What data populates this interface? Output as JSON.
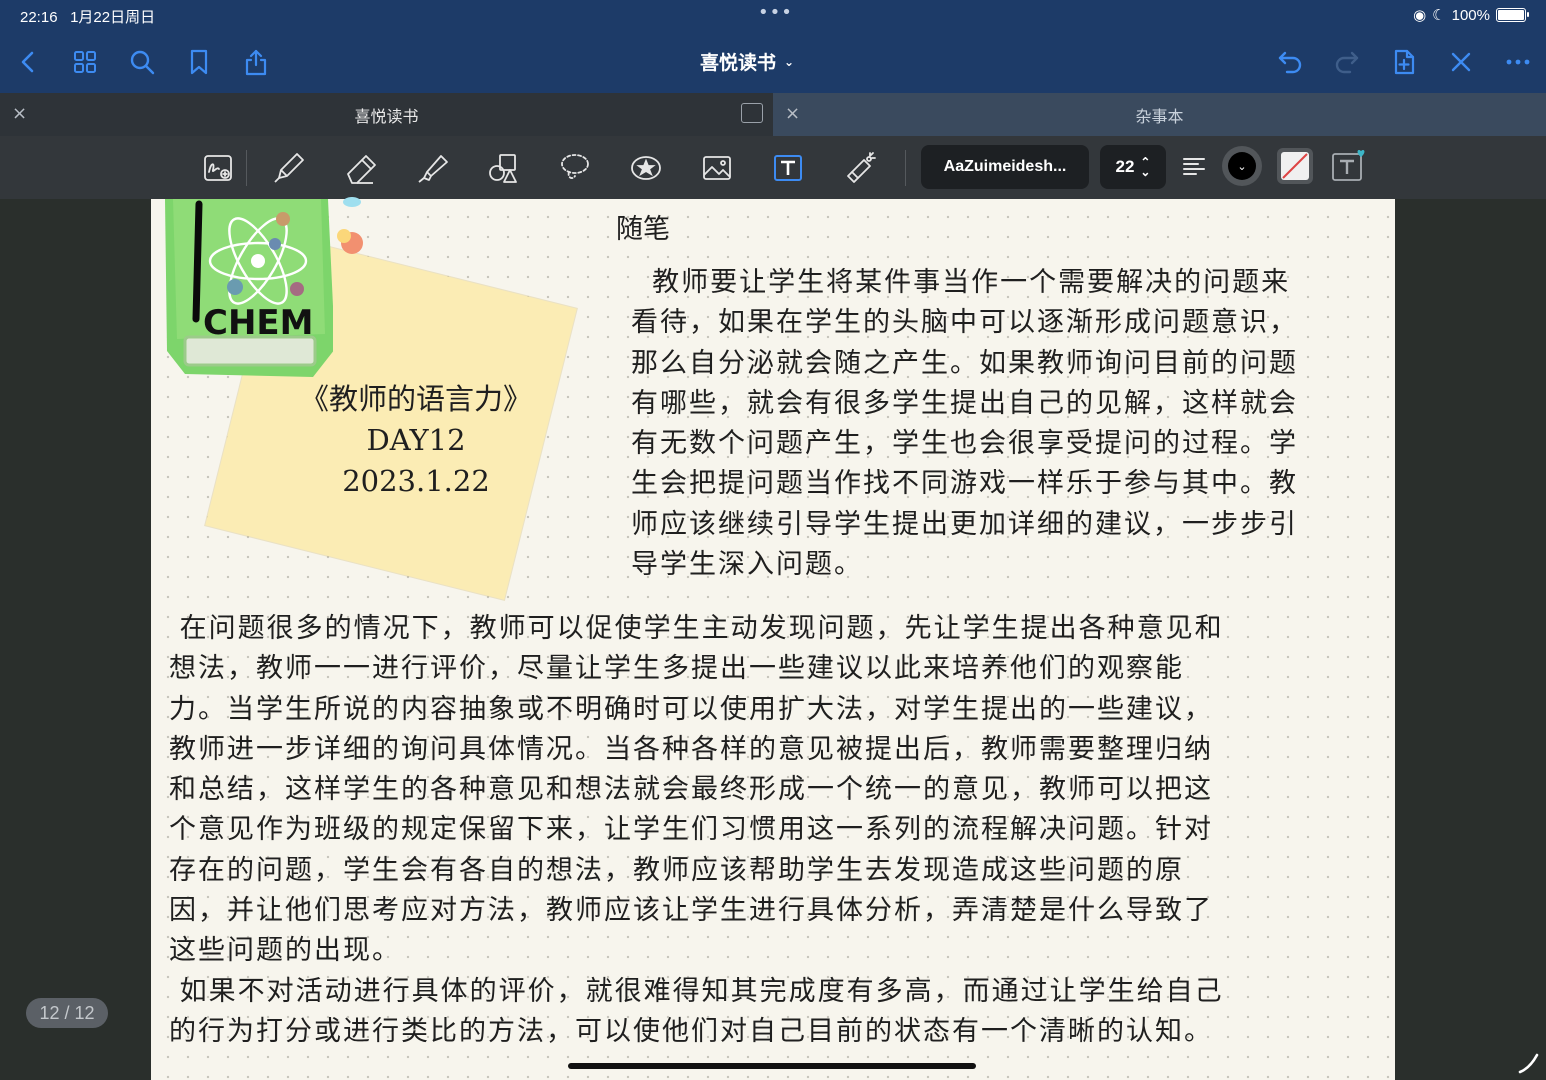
{
  "status": {
    "time": "22:16",
    "date": "1月22日周日",
    "battery": "100%"
  },
  "nav": {
    "title": "喜悦读书",
    "icons": [
      "back-icon",
      "grid-icon",
      "search-icon",
      "bookmark-icon",
      "share-icon",
      "undo-icon",
      "redo-icon",
      "add-page-icon",
      "close-icon",
      "more-icon"
    ]
  },
  "tabs": [
    {
      "label": "喜悦读书",
      "active": true
    },
    {
      "label": "杂事本",
      "active": false
    }
  ],
  "toolbar": {
    "tools": [
      "zoom-handwriting-tool",
      "pen-tool",
      "eraser-tool",
      "highlighter-tool",
      "shapes-tool",
      "lasso-tool",
      "sticker-tool",
      "image-tool",
      "text-tool",
      "laser-pointer-tool"
    ],
    "active_tool": "text-tool",
    "font_name": "AaZuimeidesh...",
    "font_size": "22",
    "accent_color": "#2f6fd6"
  },
  "page": {
    "sticky_title": "《教师的语言力》",
    "sticky_day": "DAY12",
    "sticky_date": "2023.1.22",
    "sticker_text": "CHEM",
    "heading": "随笔",
    "paragraph1": "  教师要让学生将某件事当作一个需要解决的问题来\n看待，如果在学生的头脑中可以逐渐形成问题意识，\n那么自分泌就会随之产生。如果教师询问目前的问题\n有哪些，就会有很多学生提出自己的见解，这样就会\n有无数个问题产生，学生也会很享受提问的过程。学\n生会把提问题当作找不同游戏一样乐于参与其中。教\n师应该继续引导学生提出更加详细的建议，一步步引\n导学生深入问题。",
    "paragraph2": " 在问题很多的情况下，教师可以促使学生主动发现问题，先让学生提出各种意见和\n想法，教师一一进行评价，尽量让学生多提出一些建议以此来培养他们的观察能\n力。当学生所说的内容抽象或不明确时可以使用扩大法，对学生提出的一些建议，\n教师进一步详细的询问具体情况。当各种各样的意见被提出后，教师需要整理归纳\n和总结，这样学生的各种意见和想法就会最终形成一个统一的意见，教师可以把这\n个意见作为班级的规定保留下来，让学生们习惯用这一系列的流程解决问题。针对\n存在的问题，学生会有各自的想法，教师应该帮助学生去发现造成这些问题的原\n因，并让他们思考应对方法，教师应该让学生进行具体分析，弄清楚是什么导致了\n这些问题的出现。\n 如果不对活动进行具体的评价，就很难得知其完成度有多高，而通过让学生给自己\n的行为打分或进行类比的方法，可以使他们对自己目前的状态有一个清晰的认知。"
  },
  "page_indicator": "12 / 12"
}
